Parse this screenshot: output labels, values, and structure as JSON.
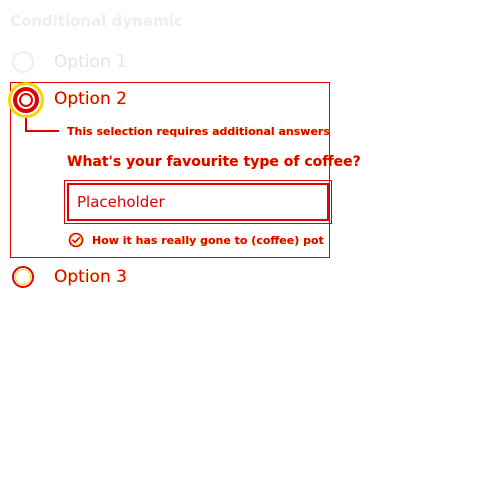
{
  "heading": "Conditional dynamic",
  "options": [
    {
      "label": "Option 1",
      "selected": false
    },
    {
      "label": "Option 2",
      "selected": true
    },
    {
      "label": "Option 3",
      "selected": false
    }
  ],
  "conditional": {
    "hint": "This selection requires additional answers",
    "question": "What's your favourite type of coffee?",
    "input": {
      "placeholder": "Placeholder",
      "value": ""
    },
    "status": "How it has really gone to (coffee) pot"
  },
  "colors": {
    "accent": "#e00000",
    "highlight": "#f4d800",
    "muted": "#eeeeee"
  },
  "icons": {
    "status": "check-circle-icon"
  }
}
